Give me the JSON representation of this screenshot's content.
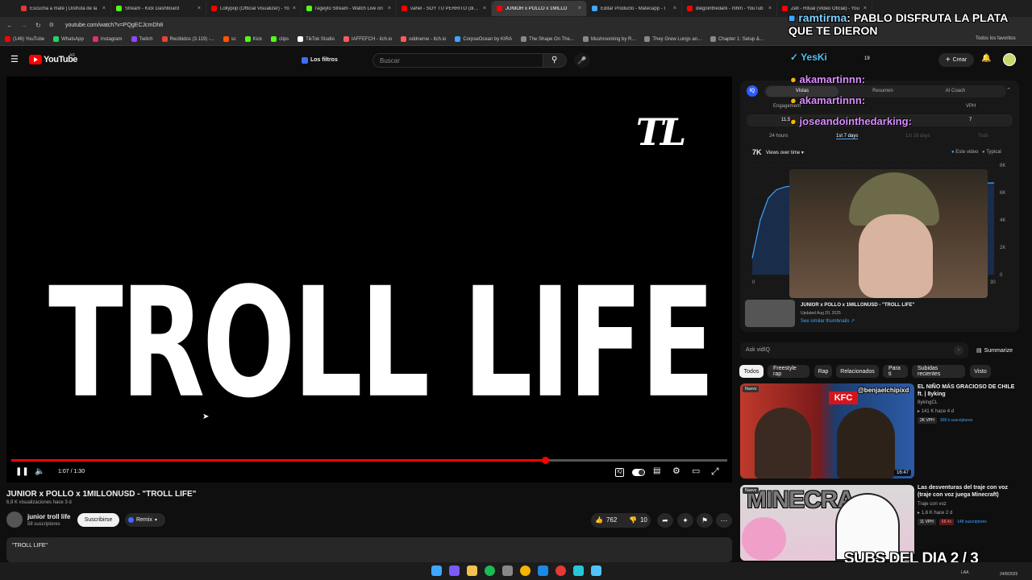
{
  "browser": {
    "tabs": [
      {
        "title": "Escucha a mate | Disfruta de la",
        "color": "#e53935"
      },
      {
        "title": "Stream - Kick Dashboard",
        "color": "#53fc18"
      },
      {
        "title": "Lollypop (Official Visualizer) - Yo",
        "color": "#ff0000"
      },
      {
        "title": "rageylo Stream - Watch Live on",
        "color": "#53fc18"
      },
      {
        "title": "vahel - SOY TU PERRITO (dir @",
        "color": "#ff0000"
      },
      {
        "title": "JUNIOR x POLLO x 1MILLO",
        "color": "#ff0000"
      },
      {
        "title": "Editar Producto - Matecapp - I",
        "color": "#3ea6ff"
      },
      {
        "title": "diegointhedark - mhm - YouTub",
        "color": "#ff0000"
      },
      {
        "title": "Zell - Ritual (Video Oficial) - You",
        "color": "#ff0000"
      }
    ],
    "url": "youtube.com/watch?v=PQgECJcmDh8",
    "bookmarks": [
      {
        "label": "(146) YouTube",
        "color": "#ff0000"
      },
      {
        "label": "WhatsApp",
        "color": "#25d366"
      },
      {
        "label": "Instagram",
        "color": "#e1306c"
      },
      {
        "label": "Twitch",
        "color": "#9146ff"
      },
      {
        "label": "Recibidos (3.119) -...",
        "color": "#ea4335"
      },
      {
        "label": "sc",
        "color": "#ff5500"
      },
      {
        "label": "Kick",
        "color": "#53fc18"
      },
      {
        "label": "clips",
        "color": "#53fc18"
      },
      {
        "label": "TikTok Studio",
        "color": "#ffffff"
      },
      {
        "label": "IAFFEFCH - itch.io",
        "color": "#fa5c5c"
      },
      {
        "label": "oddnerve - itch.io",
        "color": "#fa5c5c"
      },
      {
        "label": "CorpseOcean by KIRA",
        "color": "#3ea6ff"
      },
      {
        "label": "The Shape On The...",
        "color": "#888888"
      },
      {
        "label": "Mushrooming by R...",
        "color": "#888888"
      },
      {
        "label": "They Grew Lungs an...",
        "color": "#888888"
      },
      {
        "label": "Chapter 1: Setup &...",
        "color": "#888888"
      }
    ],
    "all_bookmarks": "Todos los favoritos"
  },
  "yt": {
    "logo": "YouTube",
    "region": "AR",
    "filters": "Los filtros",
    "search_placeholder": "Buscar",
    "create": "Crear",
    "video_overlay_title": "TROLL LIFE",
    "video_logo": "TL",
    "time": "1:07 / 1:30",
    "progress": 0.745,
    "title": "JUNIOR x POLLO x 1MILLONUSD - \"TROLL LIFE\"",
    "meta": "6,9 K visualizaciones  hace 3 d",
    "channel": "junior troll life",
    "subs": "58 suscriptores",
    "subscribe": "Suscribirse",
    "remix": "Remix",
    "likes": "762",
    "dislikes": "10",
    "description": "\"TROLL LIFE\""
  },
  "vidiq": {
    "tabs": [
      "Vistas",
      "Resumen",
      "AI Coach"
    ],
    "engagement_label": "Engagement",
    "engagement_value": "11.5",
    "vph_label": "VPH",
    "vph_value": "7",
    "ranges": [
      "24 hours",
      "1st 7 days",
      "1st 28 days",
      "Todo"
    ],
    "total": "7K",
    "views_label": "Views over time",
    "legend": [
      "Este video",
      "Typical"
    ],
    "y_ticks": [
      "8K",
      "6K",
      "4K",
      "2K",
      "0"
    ],
    "x_ticks": [
      "0",
      "30"
    ],
    "video_title": "JUNIOR x POLLO x 1MILLONUSD - \"TROLL LIFE\"",
    "updated": "Updated Aug 20, 2025",
    "similar": "See similar thumbnails",
    "ask": "Ask vidIQ",
    "summarize": "Summarize"
  },
  "chips": [
    "Todos",
    "Freestyle rap",
    "Rap",
    "Relacionados",
    "Para ti",
    "Subidas recientes",
    "Visto"
  ],
  "recs": [
    {
      "badge": "Nuevo",
      "title": "EL NIÑO MÁS GRACIOSO DE CHILE ft. | 8yking",
      "channel": "8ykingCL",
      "meta": "141 K  hace 4 d",
      "vph": "2K VPH",
      "subs": "368 k suscriptores",
      "duration": "16:47",
      "overlay": "@benjaelchipixd",
      "brand": "KFC"
    },
    {
      "badge": "Nuevo",
      "title": "Las desventuras del traje con voz (traje con voz juega Minecraft)",
      "channel": "Traje con voz",
      "meta": "1,6 K  hace 2 d",
      "vph": "11 VPH",
      "mult": "68.4x",
      "subs": "148 suscriptores",
      "overlay": "MINECRA"
    }
  ],
  "stream": {
    "chat": [
      {
        "user": "ramtirma",
        "text": "PABLO DISFRUTA LA PLATA QUE TE DIERON"
      },
      {
        "user": "YesKi",
        "text": ""
      },
      {
        "user": "akamartinnn",
        "text": ""
      },
      {
        "user": "akamartinnn",
        "text": ""
      },
      {
        "user": "joseandointhedarking",
        "text": ""
      }
    ],
    "counter": "19",
    "subs_banner": "SUBS DEL DIA 2 / 3"
  },
  "taskbar": {
    "lang": "LAA",
    "time": "",
    "date": "24/8/2025"
  }
}
